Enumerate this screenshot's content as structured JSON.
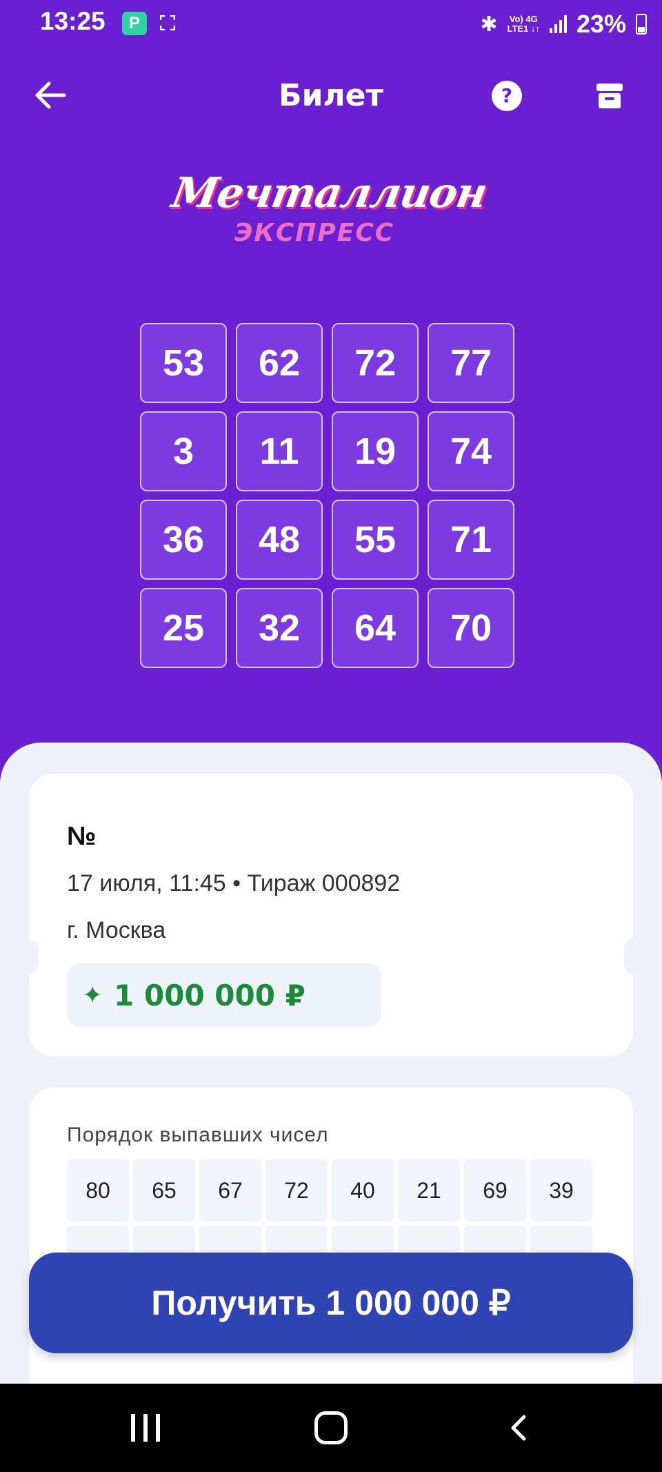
{
  "status_bar": {
    "time": "13:25",
    "app_icon_letter": "P",
    "network_top": "Vo) 4G",
    "network_bottom": "LTE1 ↓↑",
    "battery": "23%"
  },
  "header": {
    "title": "Билет",
    "help_label": "?"
  },
  "logo": {
    "main": "Мечталлион",
    "sub": "ЭКСПРЕСС"
  },
  "ticket_grid": [
    [
      "53",
      "62",
      "72",
      "77"
    ],
    [
      "3",
      "11",
      "19",
      "74"
    ],
    [
      "36",
      "48",
      "55",
      "71"
    ],
    [
      "25",
      "32",
      "64",
      "70"
    ]
  ],
  "ticket": {
    "number_label": "№",
    "date_draw": "17 июля, 11:45 • Тираж 000892",
    "city": "г. Москва",
    "prize": "1 000 000 ₽"
  },
  "draw": {
    "title": "Порядок выпавших чисел",
    "numbers": [
      "80",
      "65",
      "67",
      "72",
      "40",
      "21",
      "69",
      "39"
    ]
  },
  "claim_button": "Получить 1 000 000 ₽",
  "colors": {
    "background": "#6a1fd1",
    "accent_button": "#2f44b2",
    "prize_green": "#1b8a3a"
  }
}
